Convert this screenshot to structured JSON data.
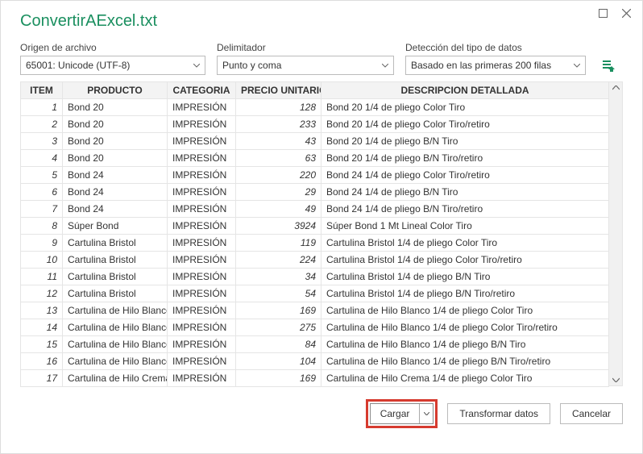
{
  "window": {
    "title": "ConvertirAExcel.txt"
  },
  "controls": {
    "origin_label": "Origen de archivo",
    "origin_value": "65001: Unicode (UTF-8)",
    "delimiter_label": "Delimitador",
    "delimiter_value": "Punto y coma",
    "detection_label": "Detección del tipo de datos",
    "detection_value": "Basado en las primeras 200 filas"
  },
  "table": {
    "headers": {
      "item": "ITEM",
      "producto": "PRODUCTO",
      "categoria": "CATEGORIA",
      "precio": "PRECIO UNITARIO",
      "descripcion": "DESCRIPCION DETALLADA"
    },
    "rows": [
      {
        "item": "1",
        "producto": "Bond 20",
        "categoria": "IMPRESIÓN",
        "precio": "128",
        "descripcion": "Bond 20 1/4 de pliego Color Tiro"
      },
      {
        "item": "2",
        "producto": "Bond 20",
        "categoria": "IMPRESIÓN",
        "precio": "233",
        "descripcion": "Bond 20 1/4 de pliego Color Tiro/retiro"
      },
      {
        "item": "3",
        "producto": "Bond 20",
        "categoria": "IMPRESIÓN",
        "precio": "43",
        "descripcion": "Bond 20 1/4 de pliego B/N Tiro"
      },
      {
        "item": "4",
        "producto": "Bond 20",
        "categoria": "IMPRESIÓN",
        "precio": "63",
        "descripcion": "Bond 20 1/4 de pliego B/N Tiro/retiro"
      },
      {
        "item": "5",
        "producto": "Bond 24",
        "categoria": "IMPRESIÓN",
        "precio": "220",
        "descripcion": "Bond 24 1/4 de pliego Color Tiro/retiro"
      },
      {
        "item": "6",
        "producto": "Bond 24",
        "categoria": "IMPRESIÓN",
        "precio": "29",
        "descripcion": "Bond 24 1/4 de pliego B/N Tiro"
      },
      {
        "item": "7",
        "producto": "Bond 24",
        "categoria": "IMPRESIÓN",
        "precio": "49",
        "descripcion": "Bond 24 1/4 de pliego B/N Tiro/retiro"
      },
      {
        "item": "8",
        "producto": "Súper Bond",
        "categoria": "IMPRESIÓN",
        "precio": "3924",
        "descripcion": "Súper Bond 1 Mt Lineal Color Tiro"
      },
      {
        "item": "9",
        "producto": "Cartulina Bristol",
        "categoria": "IMPRESIÓN",
        "precio": "119",
        "descripcion": "Cartulina Bristol 1/4 de pliego Color Tiro"
      },
      {
        "item": "10",
        "producto": "Cartulina Bristol",
        "categoria": "IMPRESIÓN",
        "precio": "224",
        "descripcion": "Cartulina Bristol 1/4 de pliego Color Tiro/retiro"
      },
      {
        "item": "11",
        "producto": "Cartulina Bristol",
        "categoria": "IMPRESIÓN",
        "precio": "34",
        "descripcion": "Cartulina Bristol 1/4 de pliego B/N Tiro"
      },
      {
        "item": "12",
        "producto": "Cartulina Bristol",
        "categoria": "IMPRESIÓN",
        "precio": "54",
        "descripcion": "Cartulina Bristol 1/4 de pliego B/N Tiro/retiro"
      },
      {
        "item": "13",
        "producto": "Cartulina de Hilo Blanco",
        "categoria": "IMPRESIÓN",
        "precio": "169",
        "descripcion": "Cartulina de Hilo Blanco 1/4 de pliego Color Tiro"
      },
      {
        "item": "14",
        "producto": "Cartulina de Hilo Blanco",
        "categoria": "IMPRESIÓN",
        "precio": "275",
        "descripcion": "Cartulina de Hilo Blanco 1/4 de pliego Color Tiro/retiro"
      },
      {
        "item": "15",
        "producto": "Cartulina de Hilo Blanco",
        "categoria": "IMPRESIÓN",
        "precio": "84",
        "descripcion": "Cartulina de Hilo Blanco 1/4 de pliego B/N Tiro"
      },
      {
        "item": "16",
        "producto": "Cartulina de Hilo Blanco",
        "categoria": "IMPRESIÓN",
        "precio": "104",
        "descripcion": "Cartulina de Hilo Blanco 1/4 de pliego B/N Tiro/retiro"
      },
      {
        "item": "17",
        "producto": "Cartulina de Hilo Crema",
        "categoria": "IMPRESIÓN",
        "precio": "169",
        "descripcion": "Cartulina de Hilo Crema 1/4 de pliego Color Tiro"
      }
    ]
  },
  "footer": {
    "load": "Cargar",
    "transform": "Transformar datos",
    "cancel": "Cancelar"
  }
}
